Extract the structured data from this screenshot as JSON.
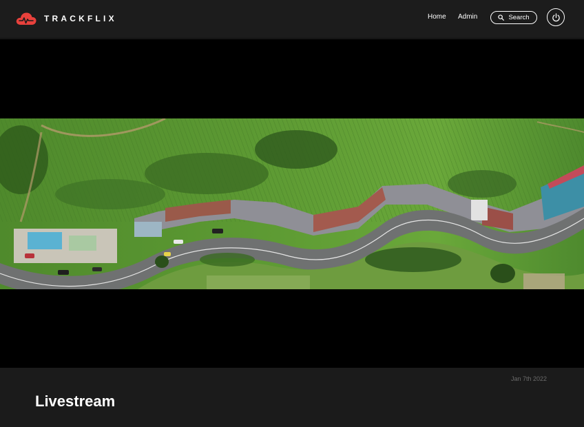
{
  "header": {
    "brand": "TRACKFLIX",
    "nav": {
      "home": "Home",
      "admin": "Admin"
    },
    "search_label": "Search",
    "icons": {
      "logo": "cloud-pulse-icon",
      "search": "search-icon",
      "power": "power-icon"
    },
    "colors": {
      "brand_accent": "#e8413c",
      "background": "#1c1c1c"
    }
  },
  "video": {
    "description_icon": "aerial-road-video-frame"
  },
  "info": {
    "date": "Jan 7th 2022",
    "title": "Livestream"
  }
}
